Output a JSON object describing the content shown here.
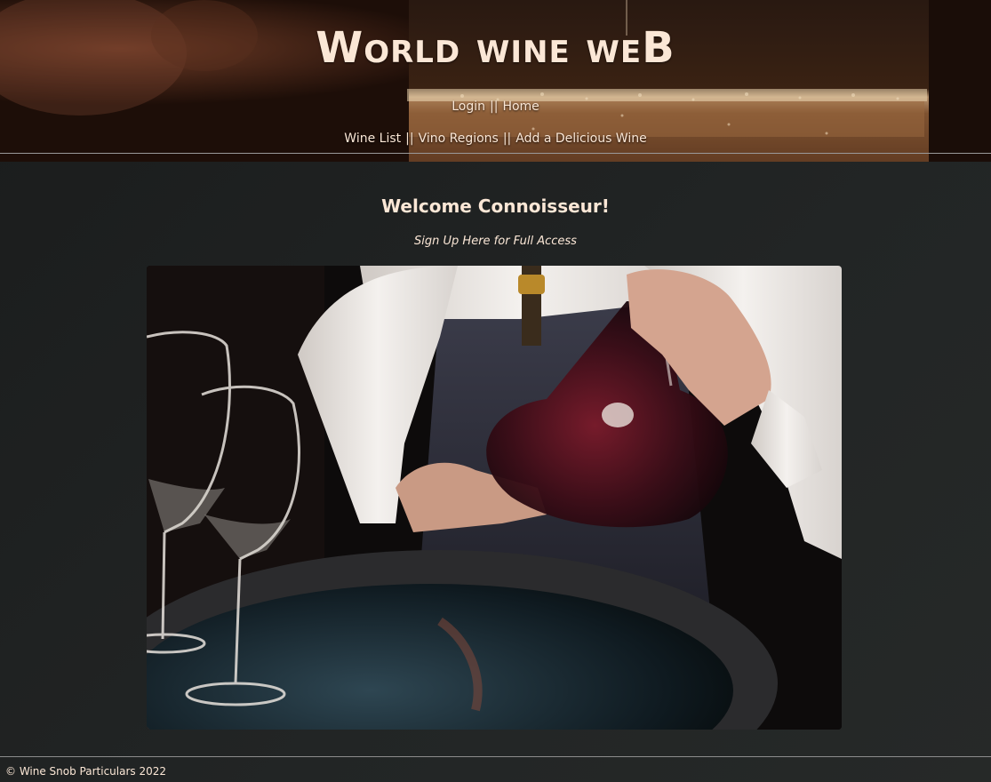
{
  "header": {
    "site_title": "World wine weB",
    "nav_top": [
      {
        "label": "Login"
      },
      {
        "label": "Home"
      }
    ],
    "nav_bottom": [
      {
        "label": "Wine List"
      },
      {
        "label": "Vino Regions"
      },
      {
        "label": "Add a Delicious Wine"
      }
    ],
    "separator": "||"
  },
  "main": {
    "welcome_heading": "Welcome Connoisseur!",
    "signup_link": "Sign Up Here for Full Access",
    "hero_image": "sommelier pouring red wine from decanter"
  },
  "footer": {
    "copyright": "© Wine Snob Particulars 2022"
  },
  "colors": {
    "text_cream": "#fbe7d6",
    "background": "#1d1f1f",
    "header_dark": "#1a0d08"
  }
}
